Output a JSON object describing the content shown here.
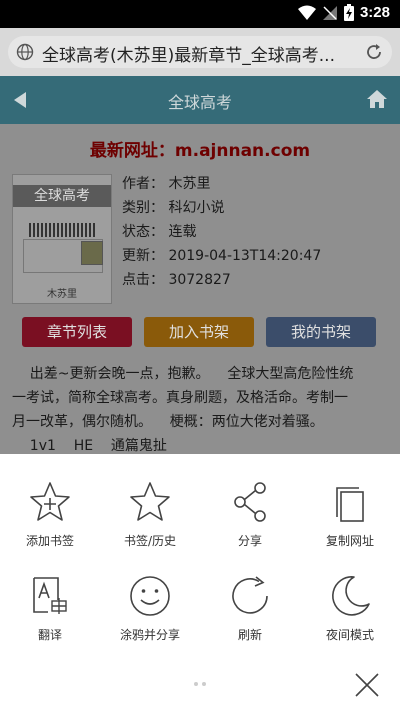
{
  "status_bar": {
    "time": "3:28"
  },
  "address_bar": {
    "url_text": "全球高考(木苏里)最新章节_全球高考..."
  },
  "web_page": {
    "header_title": "全球高考",
    "new_url_notice": "最新网址：m.ajnnan.com",
    "cover": {
      "title": "全球高考",
      "author": "木苏里"
    },
    "meta": {
      "author": "作者：  木苏里",
      "category": "类别：  科幻小说",
      "status": "状态：  连载",
      "updated": "更新：  2019-04-13T14:20:47",
      "clicks": "点击：  3072827"
    },
    "buttons": {
      "chapter_list": "章节列表",
      "add_to_shelf": "加入书架",
      "my_shelf": "我的书架"
    },
    "intro_lines": [
      "    出差~更新会晚一点，抱歉。    全球大型高危险性统",
      "一考试，简称全球高考。真身刷题，及格活命。考制一",
      "月一改革，偶尔随机。    梗概：两位大佬对着骚。",
      "    1v1    HE    通篇鬼扯"
    ]
  },
  "sheet": {
    "items": [
      {
        "label": "添加书签",
        "icon": "add-bookmark-icon"
      },
      {
        "label": "书签/历史",
        "icon": "bookmark-star-icon"
      },
      {
        "label": "分享",
        "icon": "share-icon"
      },
      {
        "label": "复制网址",
        "icon": "copy-icon"
      },
      {
        "label": "翻译",
        "icon": "translate-icon"
      },
      {
        "label": "涂鸦并分享",
        "icon": "smiley-icon"
      },
      {
        "label": "刷新",
        "icon": "refresh-icon"
      },
      {
        "label": "夜间模式",
        "icon": "moon-icon"
      }
    ]
  },
  "colors": {
    "page_header": "#356b78",
    "btn_chapter": "#7a0f22",
    "btn_add": "#8a5a0a",
    "btn_shelf": "#3b4d6a"
  }
}
